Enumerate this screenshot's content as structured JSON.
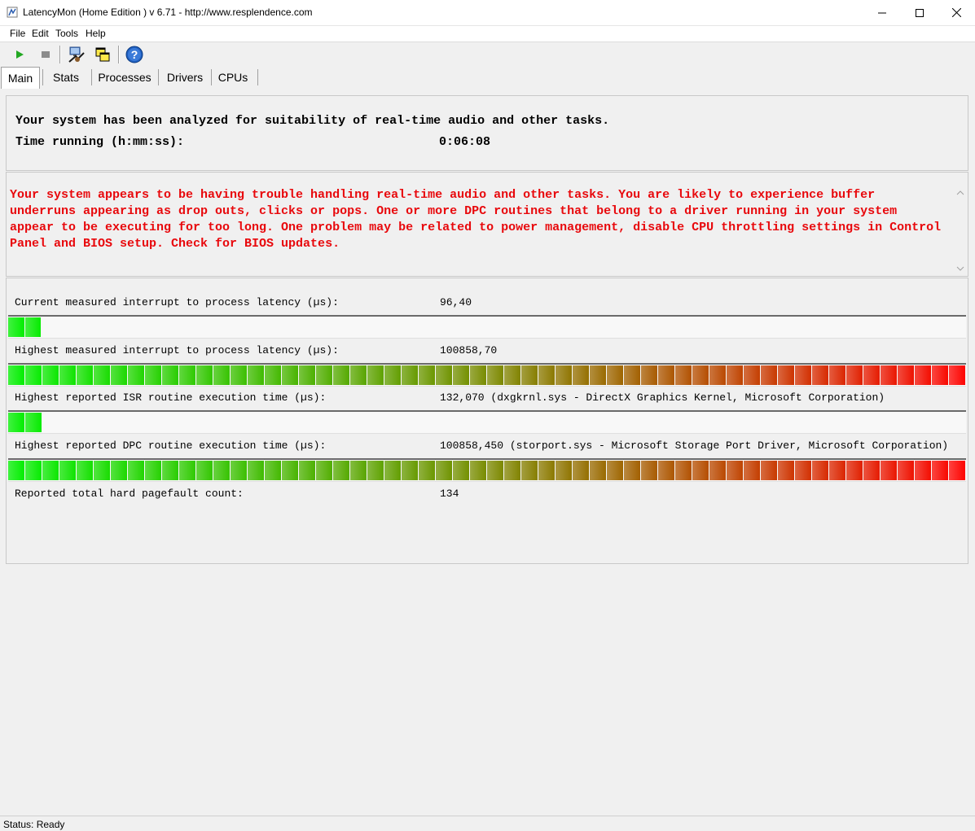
{
  "window": {
    "title": "LatencyMon  (Home Edition )  v 6.71 - http://www.resplendence.com"
  },
  "menu": {
    "items": [
      {
        "key": "file",
        "label": "File"
      },
      {
        "key": "edit",
        "label": "Edit"
      },
      {
        "key": "tools",
        "label": "Tools"
      },
      {
        "key": "help",
        "label": "Help"
      }
    ]
  },
  "toolbar": {
    "buttons": [
      {
        "key": "start",
        "icon": "play-icon",
        "color": "#22a822"
      },
      {
        "key": "stop",
        "icon": "stop-icon",
        "color": "#8c8c8c"
      },
      {
        "key": "settings",
        "icon": "computer-settings-icon"
      },
      {
        "key": "windows",
        "icon": "windows-icon"
      },
      {
        "key": "help",
        "icon": "help-icon",
        "color": "#1f5fbf"
      }
    ]
  },
  "tabs": [
    {
      "key": "main",
      "label": "Main",
      "active": true
    },
    {
      "key": "stats",
      "label": "Stats"
    },
    {
      "key": "processes",
      "label": "Processes"
    },
    {
      "key": "drivers",
      "label": "Drivers"
    },
    {
      "key": "cpus",
      "label": "CPUs"
    }
  ],
  "summary": {
    "headline": "Your system has been analyzed for suitability of real-time audio and other tasks.",
    "time_label": "Time running (h:mm:ss):",
    "time_value": "0:06:08"
  },
  "conclusion": {
    "text": "Your system appears to be having trouble handling real-time audio and other tasks. You are likely to experience buffer underruns appearing as drop outs, clicks or pops. One or more DPC routines that belong to a driver running in your system appear to be executing for too long. One problem may be related to power management, disable CPU throttling settings in Control Panel and BIOS setup. Check for BIOS updates.",
    "color": "#e8080c"
  },
  "metrics": {
    "current_latency": {
      "label": "Current measured interrupt to process latency (µs):",
      "value": "96,40",
      "fraction": 0.035
    },
    "highest_latency": {
      "label": "Highest measured interrupt to process latency (µs):",
      "value": "100858,70",
      "fraction": 1.0
    },
    "highest_isr": {
      "label": "Highest reported ISR routine execution time (µs):",
      "value": "132,070   (dxgkrnl.sys - DirectX Graphics Kernel, Microsoft Corporation)",
      "fraction": 0.036
    },
    "highest_dpc": {
      "label": "Highest reported DPC routine execution time (µs):",
      "value": "100858,450   (storport.sys - Microsoft Storage Port Driver, Microsoft Corporation)",
      "fraction": 1.0
    },
    "pagefaults": {
      "label": "Reported total hard pagefault count:",
      "value": "134"
    }
  },
  "colors": {
    "bar_start": "#00f000",
    "bar_mid": "#7a8a00",
    "bar_end": "#ff0000"
  },
  "status": {
    "text": "Status: Ready"
  }
}
